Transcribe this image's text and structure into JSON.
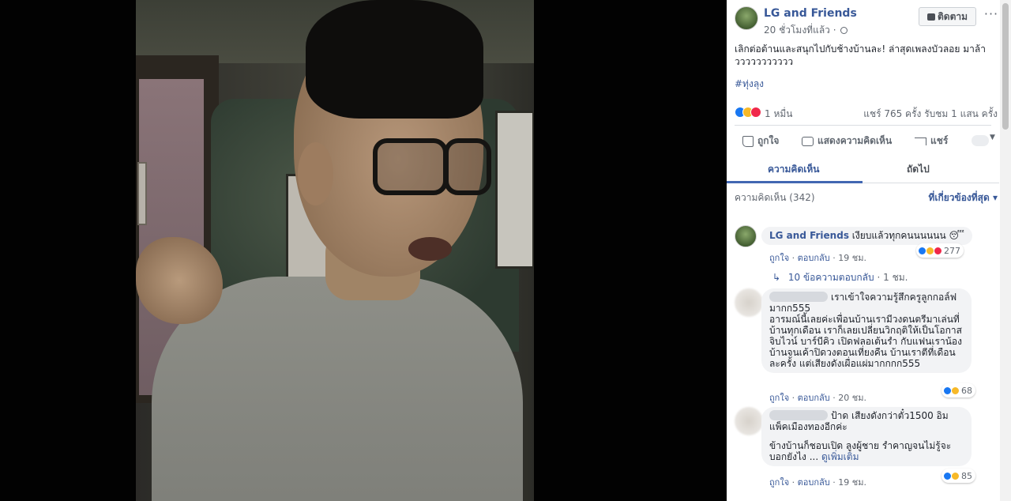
{
  "post": {
    "page_name": "LG and Friends",
    "time": "20 ชั่วโมงที่แล้ว ·",
    "follow_label": "ติดตาม",
    "more_label": "···",
    "text": "เลิกต่อต้านและสนุกไปกับช้างบ้านละ! ล่าสุดเพลงบัวลอย มาล้าววววววววววว",
    "hashtag": "#ทุ่งลุง",
    "reaction_count": "1 หมื่น",
    "stats": "แชร์ 765 ครั้ง  รับชม 1 แสน ครั้ง"
  },
  "actions": {
    "like": "ถูกใจ",
    "comment": "แสดงความคิดเห็น",
    "share": "แชร์"
  },
  "tabs": {
    "comments": "ความคิดเห็น",
    "next": "ถัดไป"
  },
  "comments_header": {
    "title": "ความคิดเห็น (342)",
    "sort": "ที่เกี่ยวข้องที่สุด ▾"
  },
  "comments": [
    {
      "author": "LG and Friends",
      "text": "เงียบแล้วทุกคนนนนนน 😴",
      "like": "ถูกใจ",
      "reply": "ตอบกลับ",
      "time": "19 ชม.",
      "reactions": "277",
      "replies_label": "10 ข้อความตอบกลับ",
      "replies_time": "· 1 ชม."
    },
    {
      "text_line1": "เราเข้าใจความรู้สึกครูลูกกอล์ฟ",
      "text_rest": "มากก555\nอารมณ์นี้เลยค่ะเพื่อนบ้านเรามีวงดนตรีมาเล่นที่บ้านทุกเดือน เราก็เลยเปลี่ยนวิกฤติให้เป็นโอกาส จิบไวน์ บาร์บีคิว เปิดฟลอเต้นรำ กับแฟนเราน้องบ้านจนเค้าปิดวงตอนเที่ยงคืน บ้านเราตีที่เดือนละครั้ง แต่เสียงดังเผื่อแผ่มากกกก555",
      "like": "ถูกใจ",
      "reply": "ตอบกลับ",
      "time": "20 ชม.",
      "reactions": "68"
    },
    {
      "text_line1": "ป้าด เสียงดังกว่าตั๋ว1500 อิมแพ็คเมืองทองอีกค่ะ",
      "text_rest": "ข้างบ้านก็ชอบเปิด ลูงผู้ชาย รำคาญจนไม่รู้จะบอกยังไง ...",
      "see_more": "ดูเพิ่มเติม",
      "like": "ถูกใจ",
      "reply": "ตอบกลับ",
      "time": "19 ชม.",
      "reactions": "85"
    }
  ]
}
